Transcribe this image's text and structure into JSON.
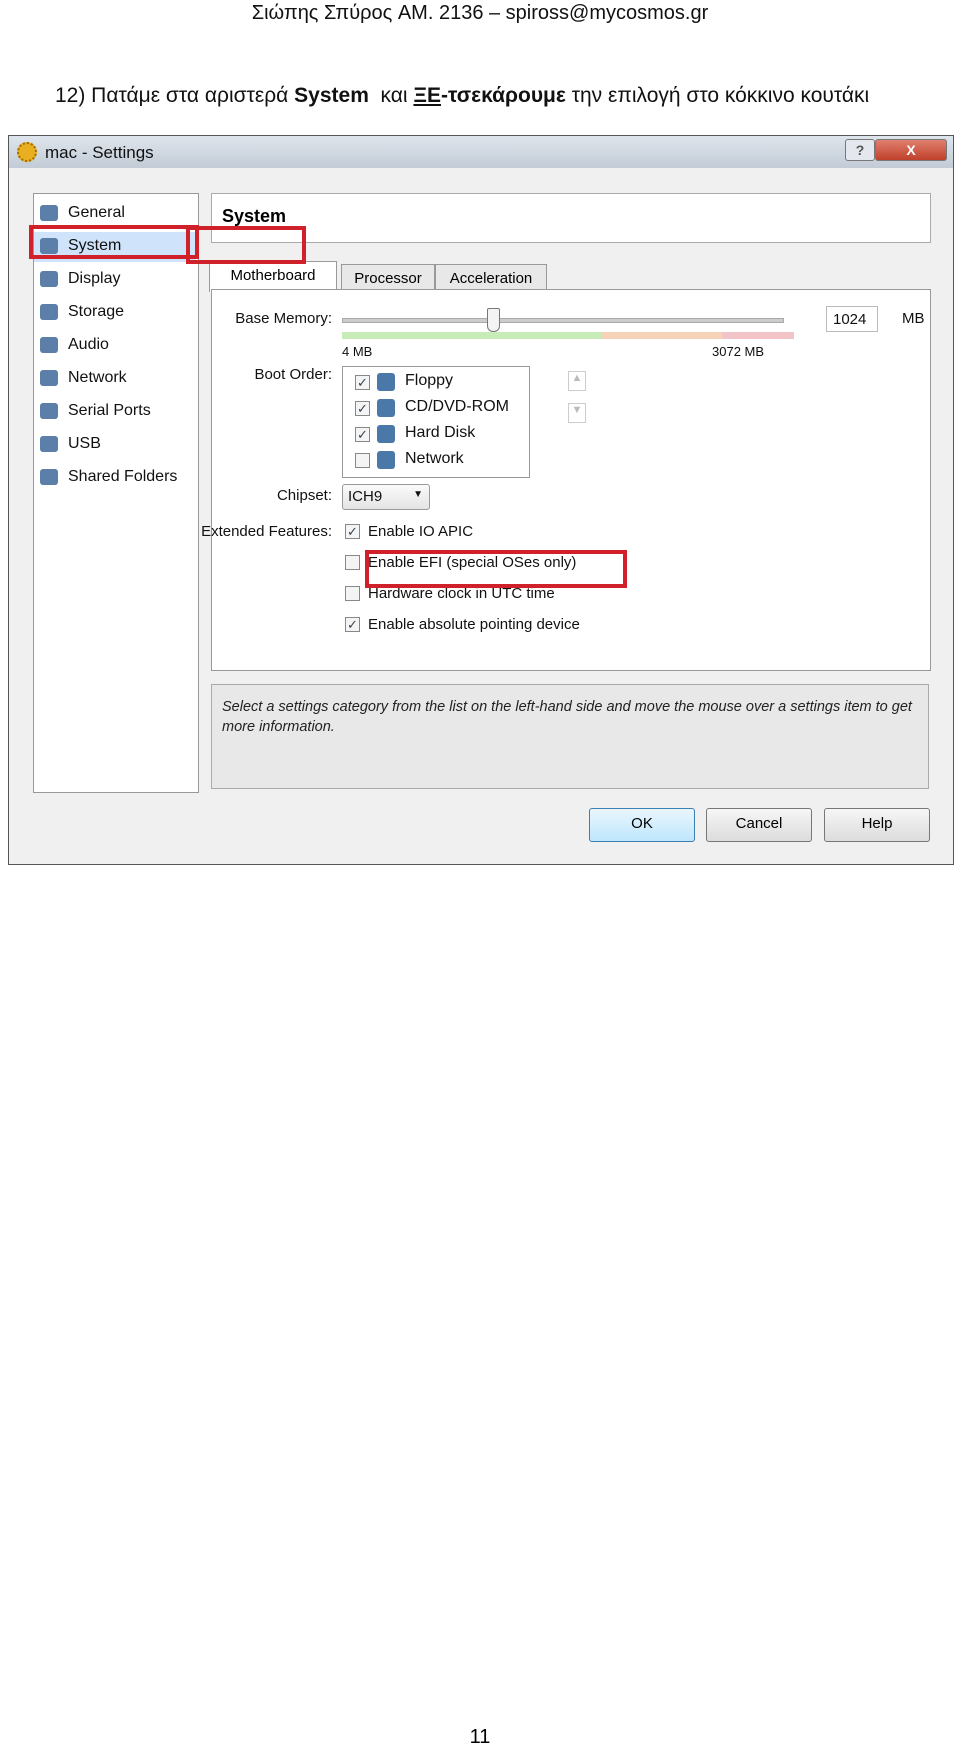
{
  "header": "Σιώπης Σπύρος AM. 2136 – spiross@mycosmos.gr",
  "instruction": {
    "prefix": "12) Πατάμε στα αριστερά ",
    "bold1": "System",
    "mid": "  και ",
    "under": "ΞΕ",
    "bold2": "-τσεκάρουμε",
    "suffix": " την επιλογή στο κόκκινο κουτάκι"
  },
  "dialog": {
    "title": "mac - Settings",
    "help": "?",
    "close": "X",
    "sidebar": [
      {
        "label": "General",
        "icon": "monitor-icon"
      },
      {
        "label": "System",
        "icon": "chip-icon",
        "selected": true
      },
      {
        "label": "Display",
        "icon": "display-icon"
      },
      {
        "label": "Storage",
        "icon": "disk-icon"
      },
      {
        "label": "Audio",
        "icon": "speaker-icon"
      },
      {
        "label": "Network",
        "icon": "network-icon"
      },
      {
        "label": "Serial Ports",
        "icon": "serial-icon"
      },
      {
        "label": "USB",
        "icon": "usb-icon"
      },
      {
        "label": "Shared Folders",
        "icon": "folder-icon"
      }
    ],
    "section": "System",
    "tabs": [
      "Motherboard",
      "Processor",
      "Acceleration"
    ],
    "base_memory": {
      "label": "Base Memory:",
      "min": "4 MB",
      "max": "3072 MB",
      "value": "1024",
      "unit": "MB",
      "fraction": 0.333
    },
    "boot_order": {
      "label": "Boot Order:",
      "items": [
        {
          "label": "Floppy",
          "checked": true
        },
        {
          "label": "CD/DVD-ROM",
          "checked": true
        },
        {
          "label": "Hard Disk",
          "checked": true
        },
        {
          "label": "Network",
          "checked": false
        }
      ]
    },
    "chipset": {
      "label": "Chipset:",
      "value": "ICH9"
    },
    "extended": {
      "label": "Extended Features:",
      "items": [
        {
          "label": "Enable IO APIC",
          "checked": true
        },
        {
          "label": "Enable EFI (special OSes only)",
          "checked": false
        },
        {
          "label": "Hardware clock in UTC time",
          "checked": false
        },
        {
          "label": "Enable absolute pointing device",
          "checked": true
        }
      ]
    },
    "info": "Select a settings category from the list on the left-hand side and move the mouse over a settings item to get more information.",
    "buttons": {
      "ok": "OK",
      "cancel": "Cancel",
      "help": "Help"
    },
    "highlight_color": "#d0202a"
  },
  "page_number": "11"
}
